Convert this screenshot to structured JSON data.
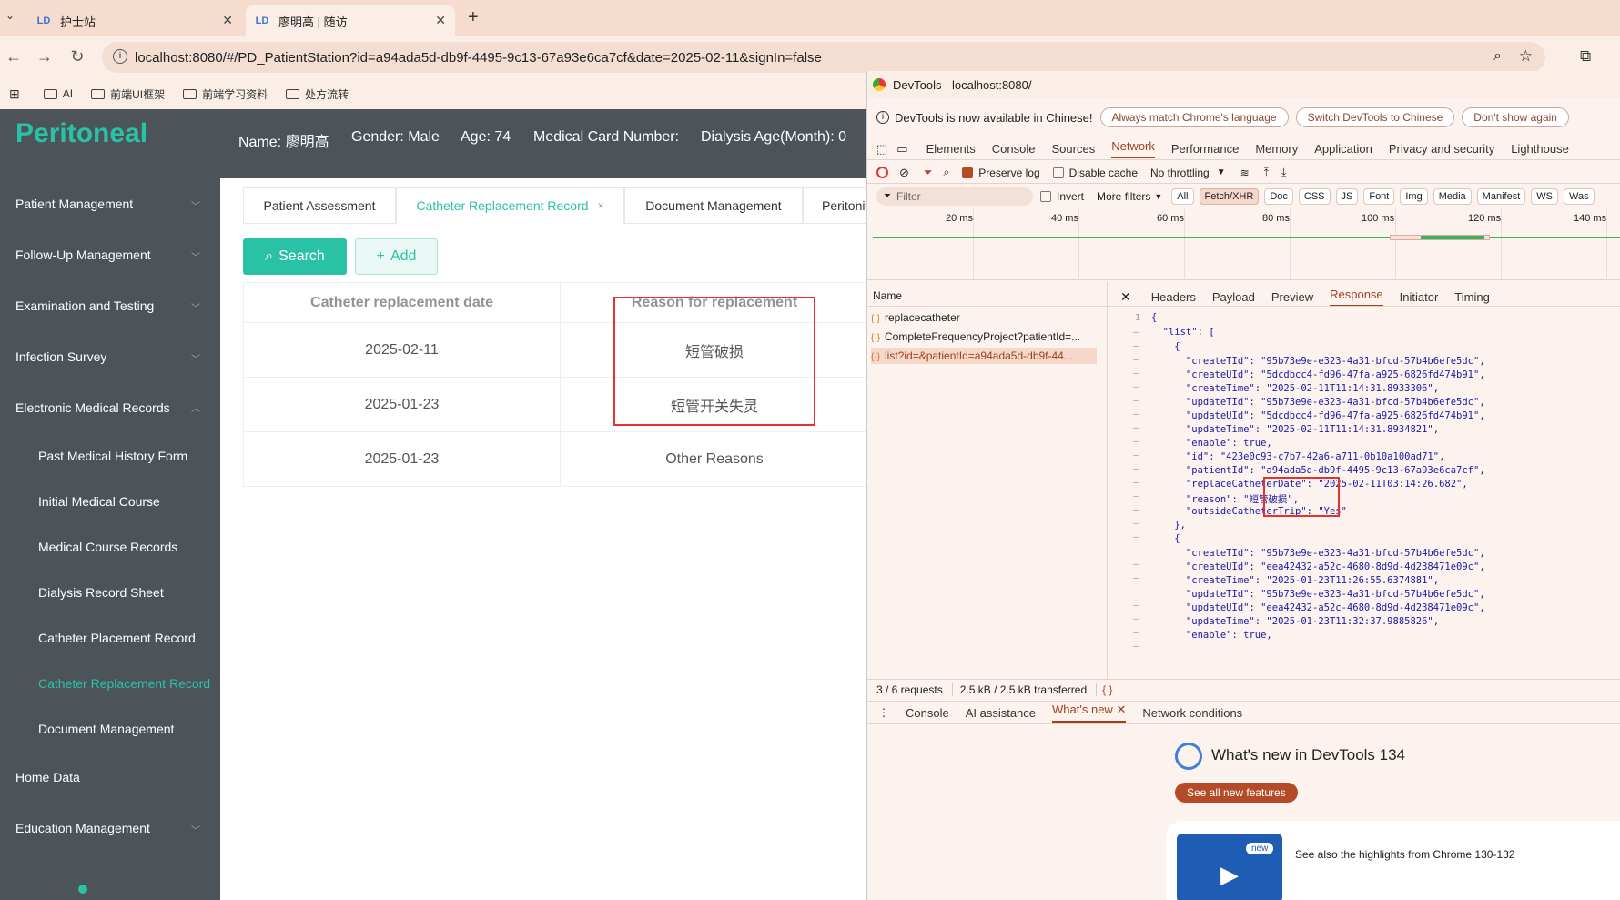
{
  "browser": {
    "tabs": [
      {
        "title": "护士站"
      },
      {
        "title": "廖明高 | 随访"
      }
    ],
    "url": "localhost:8080/#/PD_PatientStation?id=a94ada5d-db9f-4495-9c13-67a93e6ca7cf&date=2025-02-11&signIn=false",
    "bookmarks": [
      "AI",
      "前端UI框架",
      "前端学习资料",
      "处方流转"
    ]
  },
  "app": {
    "logo": "Peritoneal",
    "patient": {
      "name": "Name: 廖明高",
      "gender": "Gender: Male",
      "age": "Age: 74",
      "card": "Medical Card Number:",
      "dialysis": "Dialysis Age(Month): 0"
    },
    "sidebar": {
      "patient_mgmt": "Patient Management",
      "followup": "Follow-Up Management",
      "exam": "Examination and Testing",
      "infection": "Infection Survey",
      "emr": "Electronic Medical Records",
      "sub": [
        "Past Medical History Form",
        "Initial Medical Course",
        "Medical Course Records",
        "Dialysis Record Sheet",
        "Catheter Placement Record",
        "Catheter Replacement Record",
        "Document Management"
      ],
      "home": "Home Data",
      "education": "Education Management"
    },
    "page_tabs": [
      "Patient Assessment",
      "Catheter Replacement Record",
      "Document Management",
      "Peritonit"
    ],
    "search_label": "Search",
    "add_label": "Add",
    "table": {
      "headers": [
        "Catheter replacement date",
        "Reason for replacement"
      ],
      "rows": [
        [
          "2025-02-11",
          "短管破损"
        ],
        [
          "2025-01-23",
          "短管开关失灵"
        ],
        [
          "2025-01-23",
          "Other Reasons"
        ]
      ]
    },
    "accent": "#29c2a6"
  },
  "devtools": {
    "title": "DevTools - localhost:8080/",
    "banner": "DevTools is now available in Chinese!",
    "banner_buttons": [
      "Always match Chrome's language",
      "Switch DevTools to Chinese",
      "Don't show again"
    ],
    "panels": [
      "Elements",
      "Console",
      "Sources",
      "Network",
      "Performance",
      "Memory",
      "Application",
      "Privacy and security",
      "Lighthouse"
    ],
    "preserve_log": "Preserve log",
    "disable_cache": "Disable cache",
    "throttling": "No throttling",
    "filter_placeholder": "Filter",
    "invert": "Invert",
    "more_filters": "More filters",
    "filter_tags": [
      "All",
      "Fetch/XHR",
      "Doc",
      "CSS",
      "JS",
      "Font",
      "Img",
      "Media",
      "Manifest",
      "WS",
      "Was"
    ],
    "timeline_ticks": [
      "20 ms",
      "40 ms",
      "60 ms",
      "80 ms",
      "100 ms",
      "120 ms",
      "140 ms"
    ],
    "name_header": "Name",
    "requests": [
      "replacecatheter",
      "CompleteFrequencyProject?patientId=...",
      "list?id=&patientId=a94ada5d-db9f-44..."
    ],
    "detail_tabs": [
      "Headers",
      "Payload",
      "Preview",
      "Response",
      "Initiator",
      "Timing"
    ],
    "status": {
      "requests": "3 / 6 requests",
      "transferred": "2.5 kB / 2.5 kB transferred"
    },
    "response_lines": [
      "{",
      "  \"list\": [",
      "    {",
      "      \"createTId\": \"95b73e9e-e323-4a31-bfcd-57b4b6efe5dc\",",
      "      \"createUId\": \"5dcdbcc4-fd96-47fa-a925-6826fd474b91\",",
      "      \"createTime\": \"2025-02-11T11:14:31.8933306\",",
      "      \"updateTId\": \"95b73e9e-e323-4a31-bfcd-57b4b6efe5dc\",",
      "      \"updateUId\": \"5dcdbcc4-fd96-47fa-a925-6826fd474b91\",",
      "      \"updateTime\": \"2025-02-11T11:14:31.8934821\",",
      "      \"enable\": true,",
      "      \"id\": \"423e0c93-c7b7-42a6-a711-0b10a100ad71\",",
      "      \"patientId\": \"a94ada5d-db9f-4495-9c13-67a93e6ca7cf\",",
      "      \"replaceCatheterDate\": \"2025-02-11T03:14:26.682\",",
      "      \"reason\": \"短管破损\",",
      "      \"outsideCatheterTrip\": \"Yes\"",
      "    },",
      "    {",
      "      \"createTId\": \"95b73e9e-e323-4a31-bfcd-57b4b6efe5dc\",",
      "      \"createUId\": \"eea42432-a52c-4680-8d9d-4d238471e09c\",",
      "      \"createTime\": \"2025-01-23T11:26:55.6374881\",",
      "      \"updateTId\": \"95b73e9e-e323-4a31-bfcd-57b4b6efe5dc\",",
      "      \"updateUId\": \"eea42432-a52c-4680-8d9d-4d238471e09c\",",
      "      \"updateTime\": \"2025-01-23T11:32:37.9885826\",",
      "      \"enable\": true,"
    ],
    "drawer_tabs": [
      "Console",
      "AI assistance",
      "What's new",
      "Network conditions"
    ],
    "whats_new_title": "What's new in DevTools 134",
    "see_all": "See all new features",
    "new_badge": "new",
    "highlights": "See also the highlights from Chrome 130-132"
  }
}
